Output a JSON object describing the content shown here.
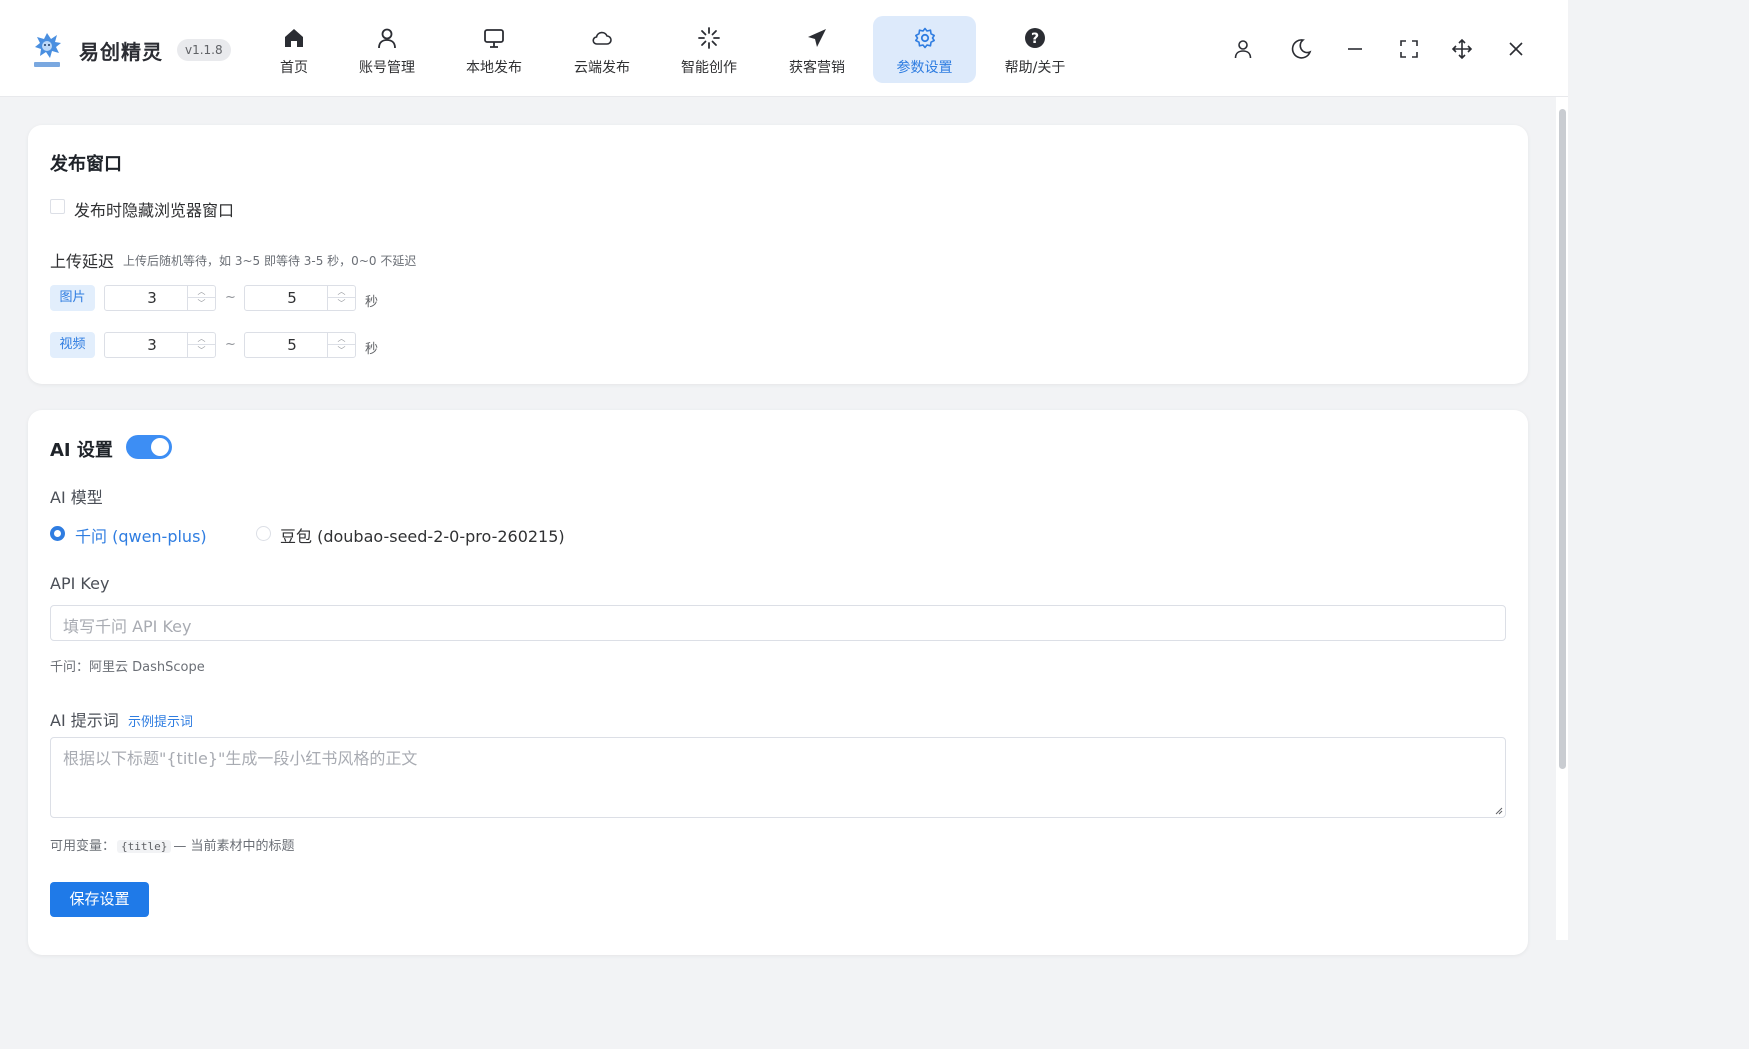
{
  "app": {
    "title": "易创精灵",
    "version": "v1.1.8",
    "logo_icon": "mascot-logo-icon"
  },
  "nav": {
    "items": [
      {
        "label": "首页",
        "icon": "home-icon"
      },
      {
        "label": "账号管理",
        "icon": "user-icon"
      },
      {
        "label": "本地发布",
        "icon": "monitor-icon"
      },
      {
        "label": "云端发布",
        "icon": "cloud-icon"
      },
      {
        "label": "智能创作",
        "icon": "sparkle-icon"
      },
      {
        "label": "获客营销",
        "icon": "paper-plane-icon"
      },
      {
        "label": "参数设置",
        "icon": "gear-icon",
        "active": true
      },
      {
        "label": "帮助/关于",
        "icon": "help-icon"
      }
    ]
  },
  "window_controls": [
    "user-icon",
    "moon-icon",
    "minimize-icon",
    "fullscreen-icon",
    "move-icon",
    "close-icon"
  ],
  "publish": {
    "title": "发布窗口",
    "hide_browser_label": "发布时隐藏浏览器窗口",
    "hide_browser_checked": false,
    "upload_delay_title": "上传延迟",
    "upload_delay_hint": "上传后随机等待，如 3~5 即等待 3-5 秒，0~0 不延迟",
    "rows": [
      {
        "tag": "图片",
        "min": "3",
        "max": "5",
        "sep": "~",
        "unit": "秒"
      },
      {
        "tag": "视频",
        "min": "3",
        "max": "5",
        "sep": "~",
        "unit": "秒"
      }
    ]
  },
  "ai": {
    "title": "AI 设置",
    "enabled": true,
    "model_label": "AI 模型",
    "models": [
      {
        "label": "千问 (qwen-plus)",
        "selected": true
      },
      {
        "label": "豆包 (doubao-seed-2-0-pro-260215)",
        "selected": false
      }
    ],
    "api_key_label": "API Key",
    "api_key_placeholder": "填写千问 API Key",
    "api_key_note": "千问：阿里云 DashScope",
    "prompt_label": "AI 提示词",
    "prompt_example_link": "示例提示词",
    "prompt_placeholder": "根据以下标题\"{title}\"生成一段小红书风格的正文",
    "vars_prefix": "可用变量：",
    "vars_code": "{title}",
    "vars_suffix": "— 当前素材中的标题",
    "save_label": "保存设置"
  },
  "colors": {
    "accent": "#2f7de1",
    "primary_button": "#1f7ae8",
    "switch_on": "#3d8ef4",
    "tag_bg": "#e2eefc",
    "active_nav_bg": "#ddeafb"
  }
}
